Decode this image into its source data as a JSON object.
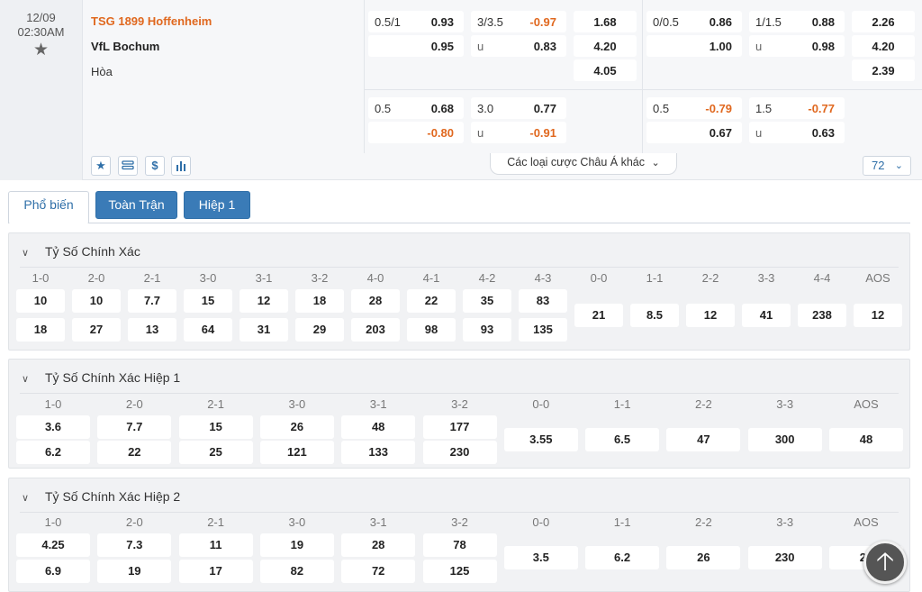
{
  "match": {
    "date": "12/09",
    "time": "02:30AM",
    "home": "TSG 1899 Hoffenheim",
    "away": "VfL Bochum",
    "draw": "Hòa"
  },
  "odds": {
    "ft_row1": {
      "hdp_line": "0.5/1",
      "hdp_home": "0.93",
      "hdp_away": "0.95",
      "ou_line": "3/3.5",
      "ou_over": "-0.97",
      "ou_under_label": "u",
      "ou_under": "0.83",
      "x12_home": "1.68",
      "x12_away": "4.20",
      "x12_draw": "4.05"
    },
    "h1_row1": {
      "hdp_line": "0/0.5",
      "hdp_home": "0.86",
      "hdp_away": "1.00",
      "ou_line": "1/1.5",
      "ou_over": "0.88",
      "ou_under_label": "u",
      "ou_under": "0.98",
      "x12_home": "2.26",
      "x12_away": "4.20",
      "x12_draw": "2.39"
    },
    "ft_row2": {
      "hdp_line": "0.5",
      "hdp_home": "0.68",
      "hdp_away": "-0.80",
      "ou_line": "3.0",
      "ou_over": "0.77",
      "ou_under_label": "u",
      "ou_under": "-0.91"
    },
    "h1_row2": {
      "hdp_line": "0.5",
      "hdp_home": "-0.79",
      "hdp_away": "0.67",
      "ou_line": "1.5",
      "ou_over": "-0.77",
      "ou_under_label": "u",
      "ou_under": "0.63"
    }
  },
  "toolbar": {
    "more_asian": "Các loại cược Châu Á khác",
    "market_count": "72"
  },
  "tabs": [
    "Phổ biến",
    "Toàn Trận",
    "Hiệp 1"
  ],
  "sections": {
    "full": {
      "title": "Tỷ Số Chính Xác",
      "home_scores": [
        "1-0",
        "2-0",
        "2-1",
        "3-0",
        "3-1",
        "3-2",
        "4-0",
        "4-1",
        "4-2",
        "4-3"
      ],
      "home_odds": [
        "10",
        "10",
        "7.7",
        "15",
        "12",
        "18",
        "28",
        "22",
        "35",
        "83"
      ],
      "away_odds": [
        "18",
        "27",
        "13",
        "64",
        "31",
        "29",
        "203",
        "98",
        "93",
        "135"
      ],
      "draw_scores": [
        "0-0",
        "1-1",
        "2-2",
        "3-3",
        "4-4",
        "AOS"
      ],
      "draw_odds": [
        "21",
        "8.5",
        "12",
        "41",
        "238",
        "12"
      ]
    },
    "h1": {
      "title": "Tỷ Số Chính Xác Hiệp 1",
      "home_scores": [
        "1-0",
        "2-0",
        "2-1",
        "3-0",
        "3-1",
        "3-2"
      ],
      "home_odds": [
        "3.6",
        "7.7",
        "15",
        "26",
        "48",
        "177"
      ],
      "away_odds": [
        "6.2",
        "22",
        "25",
        "121",
        "133",
        "230"
      ],
      "draw_scores": [
        "0-0",
        "1-1",
        "2-2",
        "3-3",
        "AOS"
      ],
      "draw_odds": [
        "3.55",
        "6.5",
        "47",
        "300",
        "48"
      ]
    },
    "h2": {
      "title": "Tỷ Số Chính Xác Hiệp 2",
      "home_scores": [
        "1-0",
        "2-0",
        "2-1",
        "3-0",
        "3-1",
        "3-2"
      ],
      "home_odds": [
        "4.25",
        "7.3",
        "11",
        "19",
        "28",
        "78"
      ],
      "away_odds": [
        "6.9",
        "19",
        "17",
        "82",
        "72",
        "125"
      ],
      "draw_scores": [
        "0-0",
        "1-1",
        "2-2",
        "3-3",
        "AOS"
      ],
      "draw_odds": [
        "3.5",
        "6.2",
        "26",
        "230",
        "22"
      ]
    }
  },
  "colors": {
    "accent": "#3a7bb7",
    "negative": "#e0681f",
    "home_team": "#e0681f"
  }
}
